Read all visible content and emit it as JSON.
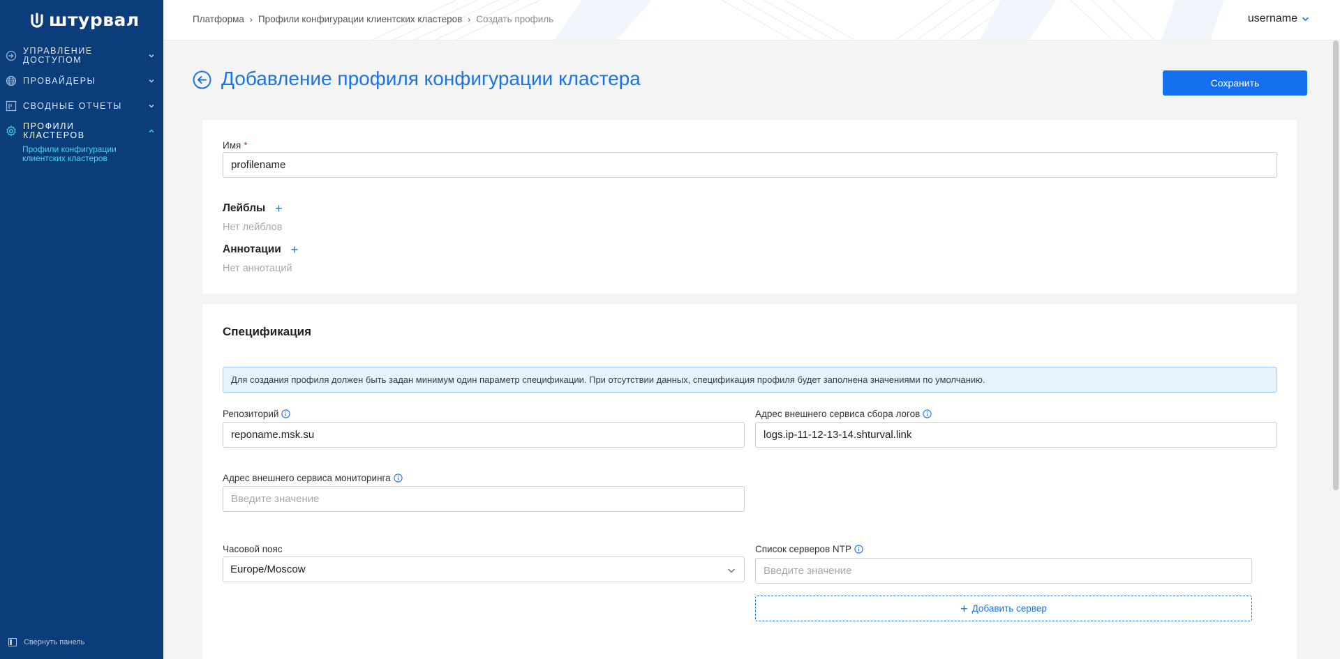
{
  "app": {
    "logo_text": "штурвал"
  },
  "sidebar": {
    "items": [
      {
        "label": "Управление доступом",
        "icon": "login-icon",
        "expanded": false
      },
      {
        "label": "Провайдеры",
        "icon": "globe-icon",
        "expanded": false
      },
      {
        "label": "Сводные отчеты",
        "icon": "report-icon",
        "expanded": false
      },
      {
        "label": "Профили кластеров",
        "icon": "gear-icon",
        "expanded": true
      }
    ],
    "subitem": "Профили конфигурации клиентских кластеров",
    "collapse_label": "Свернуть панель"
  },
  "header": {
    "breadcrumb": [
      "Платформа",
      "Профили конфигурации клиентских кластеров",
      "Создать профиль"
    ],
    "user": "username"
  },
  "page": {
    "title": "Добавление профиля конфигурации кластера",
    "save_label": "Сохранить"
  },
  "general": {
    "name_label": "Имя",
    "name_required": "*",
    "name_value": "profilename",
    "labels_title": "Лейблы",
    "labels_empty": "Нет лейблов",
    "annotations_title": "Аннотации",
    "annotations_empty": "Нет аннотаций"
  },
  "spec": {
    "title": "Спецификация",
    "info": "Для создания профиля должен быть задан минимум один параметр спецификации. При отсутствии данных, спецификация профиля будет заполнена значениями по умолчанию.",
    "repo_label": "Репозиторий",
    "repo_value": "reponame.msk.su",
    "logs_label": "Адрес внешнего сервиса сбора логов",
    "logs_value": "logs.ip-11-12-13-14.shturval.link",
    "monitoring_label": "Адрес внешнего сервиса мониторинга",
    "monitoring_placeholder": "Введите значение",
    "timezone_label": "Часовой пояс",
    "timezone_value": "Europe/Moscow",
    "ntp_label": "Список серверов NTP",
    "ntp_placeholder": "Введите значение",
    "add_server_label": "Добавить сервер"
  },
  "colors": {
    "sidebar_bg": "#0b3d7a",
    "accent": "#1a73e8",
    "button": "#1570ef",
    "sub_active": "#49d7ea",
    "info_bg": "#e6f3fd"
  }
}
